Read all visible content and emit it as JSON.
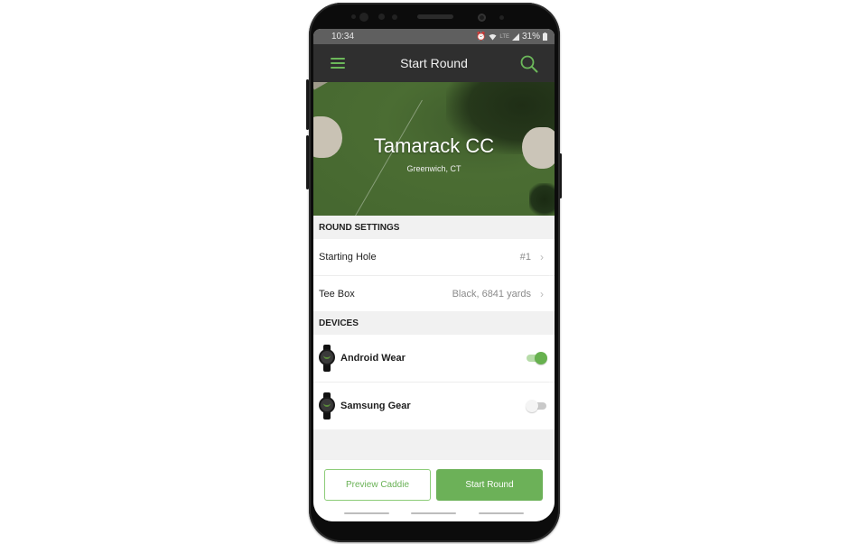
{
  "status_bar": {
    "time": "10:34",
    "battery": "31%",
    "icons": [
      "alarm-icon",
      "wifi-icon",
      "lte-icon",
      "signal-icon",
      "battery-icon"
    ]
  },
  "app_bar": {
    "title": "Start Round",
    "menu_icon": "hamburger-menu-icon",
    "search_icon": "search-icon"
  },
  "course": {
    "name": "Tamarack CC",
    "location": "Greenwich, CT"
  },
  "round_settings": {
    "header": "ROUND SETTINGS",
    "items": [
      {
        "label": "Starting Hole",
        "value": "#1"
      },
      {
        "label": "Tee Box",
        "value": "Black, 6841 yards"
      }
    ]
  },
  "devices": {
    "header": "DEVICES",
    "items": [
      {
        "name": "Android Wear",
        "enabled": true
      },
      {
        "name": "Samsung Gear",
        "enabled": false
      }
    ]
  },
  "footer": {
    "preview_label": "Preview Caddie",
    "start_label": "Start Round"
  },
  "colors": {
    "accent": "#6cb158",
    "app_bar": "#2f2f2f",
    "status_bar": "#5f5f5f"
  }
}
